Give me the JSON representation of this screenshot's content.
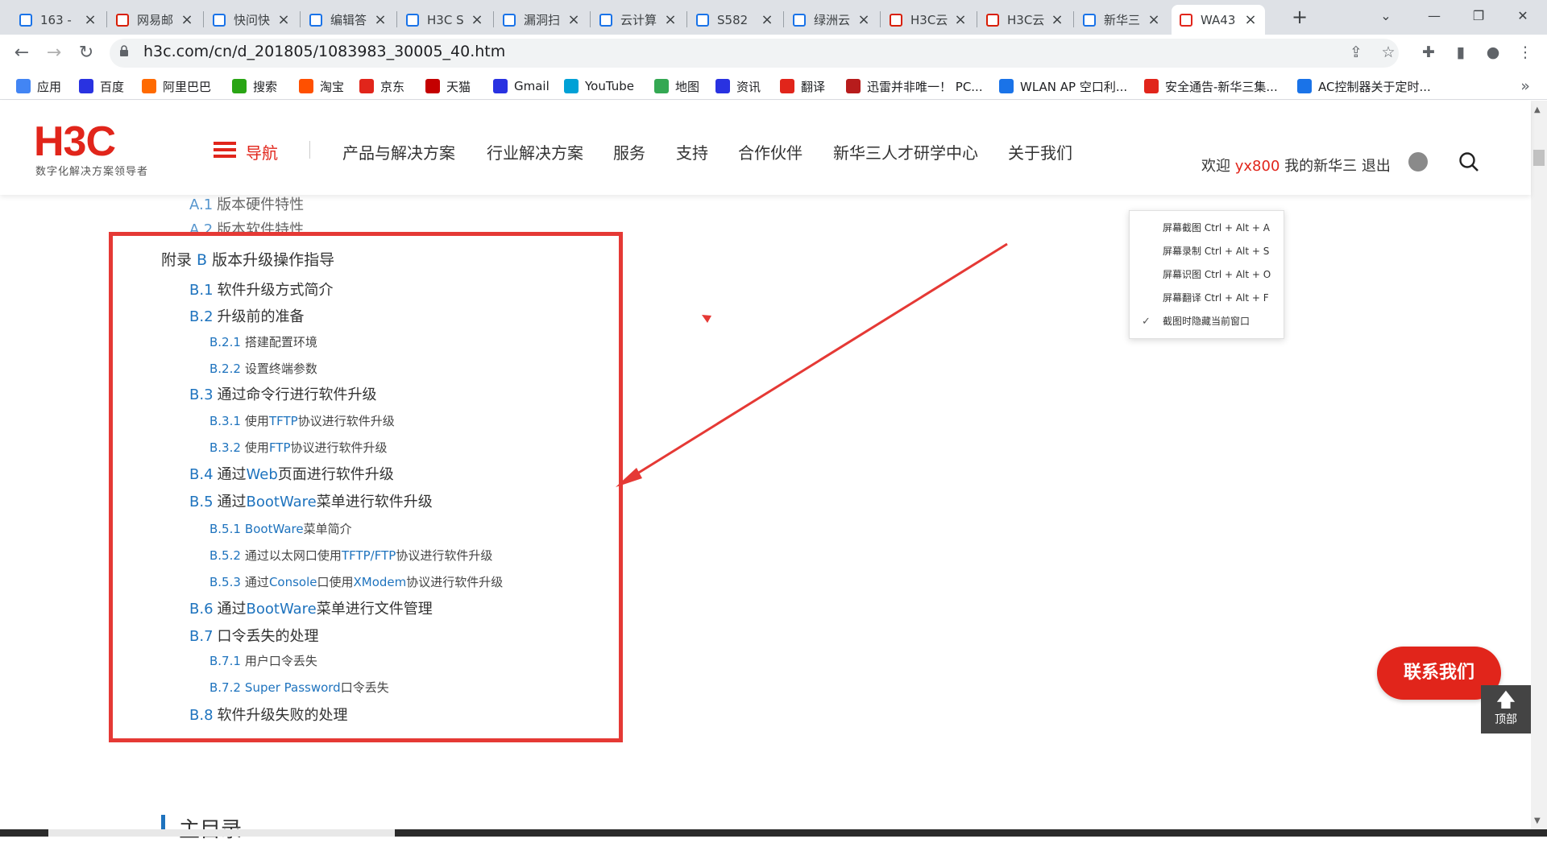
{
  "tabs": [
    {
      "title": "163 -",
      "favicon": "bing-icon",
      "color": "#1a73e8"
    },
    {
      "title": "网易邮",
      "favicon": "netease-icon",
      "color": "#d81e06"
    },
    {
      "title": "快问快",
      "favicon": "doc-icon",
      "color": "#1a73e8"
    },
    {
      "title": "编辑答",
      "favicon": "doc-icon",
      "color": "#1a73e8"
    },
    {
      "title": "H3C S",
      "favicon": "doc-icon",
      "color": "#1a73e8"
    },
    {
      "title": "漏洞扫",
      "favicon": "doc-icon",
      "color": "#1a73e8"
    },
    {
      "title": "云计算",
      "favicon": "doc-icon",
      "color": "#1a73e8"
    },
    {
      "title": "S582",
      "favicon": "doc-icon",
      "color": "#1a73e8"
    },
    {
      "title": "绿洲云",
      "favicon": "bing-icon",
      "color": "#1a73e8"
    },
    {
      "title": "H3C云",
      "favicon": "cloud-icon",
      "color": "#d81e06"
    },
    {
      "title": "H3C云",
      "favicon": "cloud-icon",
      "color": "#d81e06"
    },
    {
      "title": "新华三",
      "favicon": "bing-icon",
      "color": "#1a73e8"
    },
    {
      "title": "WA43",
      "favicon": "h3c-icon",
      "color": "#e1251b"
    }
  ],
  "address": {
    "url": "h3c.com/cn/d_201805/1083983_30005_40.htm"
  },
  "bookmarks": [
    {
      "label": "应用",
      "icon": "apps-icon",
      "color": "#4285f4"
    },
    {
      "label": "百度",
      "icon": "baidu-icon",
      "color": "#2932e1"
    },
    {
      "label": "阿里巴巴",
      "icon": "alibaba-icon",
      "color": "#ff6a00"
    },
    {
      "label": "搜索",
      "icon": "search-ring-icon",
      "color": "#2aa515"
    },
    {
      "label": "淘宝",
      "icon": "taobao-icon",
      "color": "#ff5000"
    },
    {
      "label": "京东",
      "icon": "jd-icon",
      "color": "#e1251b"
    },
    {
      "label": "天猫",
      "icon": "tmall-icon",
      "color": "#c40000"
    },
    {
      "label": "Gmail",
      "icon": "baidu-icon",
      "color": "#2932e1"
    },
    {
      "label": "YouTube",
      "icon": "tv-icon",
      "color": "#00a1d6"
    },
    {
      "label": "地图",
      "icon": "maps-icon",
      "color": "#34a853"
    },
    {
      "label": "资讯",
      "icon": "baidu-icon",
      "color": "#2932e1"
    },
    {
      "label": "翻译",
      "icon": "youdao-icon",
      "color": "#e1251b"
    },
    {
      "label": "迅雷并非唯一！ PC...",
      "icon": "red-flag-icon",
      "color": "#b71c1c"
    },
    {
      "label": "WLAN AP 空口利...",
      "icon": "doc-icon",
      "color": "#1a73e8"
    },
    {
      "label": "安全通告-新华三集...",
      "icon": "h3c-icon",
      "color": "#e1251b"
    },
    {
      "label": "AC控制器关于定时...",
      "icon": "doc-icon",
      "color": "#1a73e8"
    }
  ],
  "header": {
    "logo": "H3C",
    "logo_sub": "数字化解决方案领导者",
    "nav_label": "导航",
    "nav_items": [
      "产品与解决方案",
      "行业解决方案",
      "服务",
      "支持",
      "合作伙伴",
      "新华三人才研学中心",
      "关于我们"
    ],
    "welcome_prefix": "欢迎",
    "username": "yx800",
    "my_link": "我的新华三",
    "logout": "退出"
  },
  "toc": [
    {
      "id": "A.1",
      "parts": [
        [
          "A.1",
          "版本硬件特性"
        ]
      ],
      "level": 1,
      "top": 0
    },
    {
      "id": "A.2",
      "parts": [
        [
          "A.2",
          "版本软件特性"
        ]
      ],
      "level": 1
    },
    {
      "id": "B",
      "parts": [
        [
          "附录 ",
          "B",
          " 版本升级操作指导"
        ]
      ],
      "level": 0
    },
    {
      "id": "B.1",
      "parts": [
        [
          "B.1",
          "软件升级方式简介"
        ]
      ],
      "level": 1
    },
    {
      "id": "B.2",
      "parts": [
        [
          "B.2",
          "升级前的准备"
        ]
      ],
      "level": 1
    },
    {
      "id": "B.2.1",
      "parts": [
        [
          "B.2.1",
          "搭建配置环境"
        ]
      ],
      "level": 2
    },
    {
      "id": "B.2.2",
      "parts": [
        [
          "B.2.2",
          "设置终端参数"
        ]
      ],
      "level": 2
    },
    {
      "id": "B.3",
      "parts": [
        [
          "B.3",
          "通过命令行进行软件升级"
        ]
      ],
      "level": 1
    },
    {
      "id": "B.3.1",
      "parts": [
        [
          "B.3.1",
          "使用",
          "TFTP",
          "协议进行软件升级"
        ]
      ],
      "level": 2
    },
    {
      "id": "B.3.2",
      "parts": [
        [
          "B.3.2",
          "使用",
          "FTP",
          "协议进行软件升级"
        ]
      ],
      "level": 2
    },
    {
      "id": "B.4",
      "parts": [
        [
          "B.4",
          "通过",
          "Web",
          "页面进行软件升级"
        ]
      ],
      "level": 1
    },
    {
      "id": "B.5",
      "parts": [
        [
          "B.5",
          "通过",
          "BootWare",
          "菜单进行软件升级"
        ]
      ],
      "level": 1
    },
    {
      "id": "B.5.1",
      "parts": [
        [
          "B.5.1",
          "BootWare",
          "菜单简介"
        ]
      ],
      "level": 2
    },
    {
      "id": "B.5.2",
      "parts": [
        [
          "B.5.2",
          "通过以太网口使用",
          "TFTP/FTP",
          "协议进行软件升级"
        ]
      ],
      "level": 2
    },
    {
      "id": "B.5.3",
      "parts": [
        [
          "B.5.3",
          "通过",
          "Console",
          "口使用",
          "XModem",
          "协议进行软件升级"
        ]
      ],
      "level": 2
    },
    {
      "id": "B.6",
      "parts": [
        [
          "B.6",
          "通过",
          "BootWare",
          "菜单进行文件管理"
        ]
      ],
      "level": 1
    },
    {
      "id": "B.7",
      "parts": [
        [
          "B.7",
          "口令丢失的处理"
        ]
      ],
      "level": 1
    },
    {
      "id": "B.7.1",
      "parts": [
        [
          "B.7.1",
          "用户口令丢失"
        ]
      ],
      "level": 2
    },
    {
      "id": "B.7.2",
      "parts": [
        [
          "B.7.2",
          "Super Password",
          "口令丢失"
        ]
      ],
      "level": 2
    },
    {
      "id": "B.8",
      "parts": [
        [
          "B.8",
          "软件升级失败的处理"
        ]
      ],
      "level": 1
    }
  ],
  "section_title": "主目录",
  "popup": {
    "items": [
      "屏幕截图 Ctrl + Alt + A",
      "屏幕录制 Ctrl + Alt + S",
      "屏幕识图 Ctrl + Alt + O",
      "屏幕翻译 Ctrl + Alt + F",
      "截图时隐藏当前窗口"
    ],
    "checked_index": 4
  },
  "contact_button": "联系我们",
  "top_button": "顶部",
  "colors": {
    "brand": "#e1251b",
    "link": "#1e73be",
    "annotation": "#e53935"
  }
}
